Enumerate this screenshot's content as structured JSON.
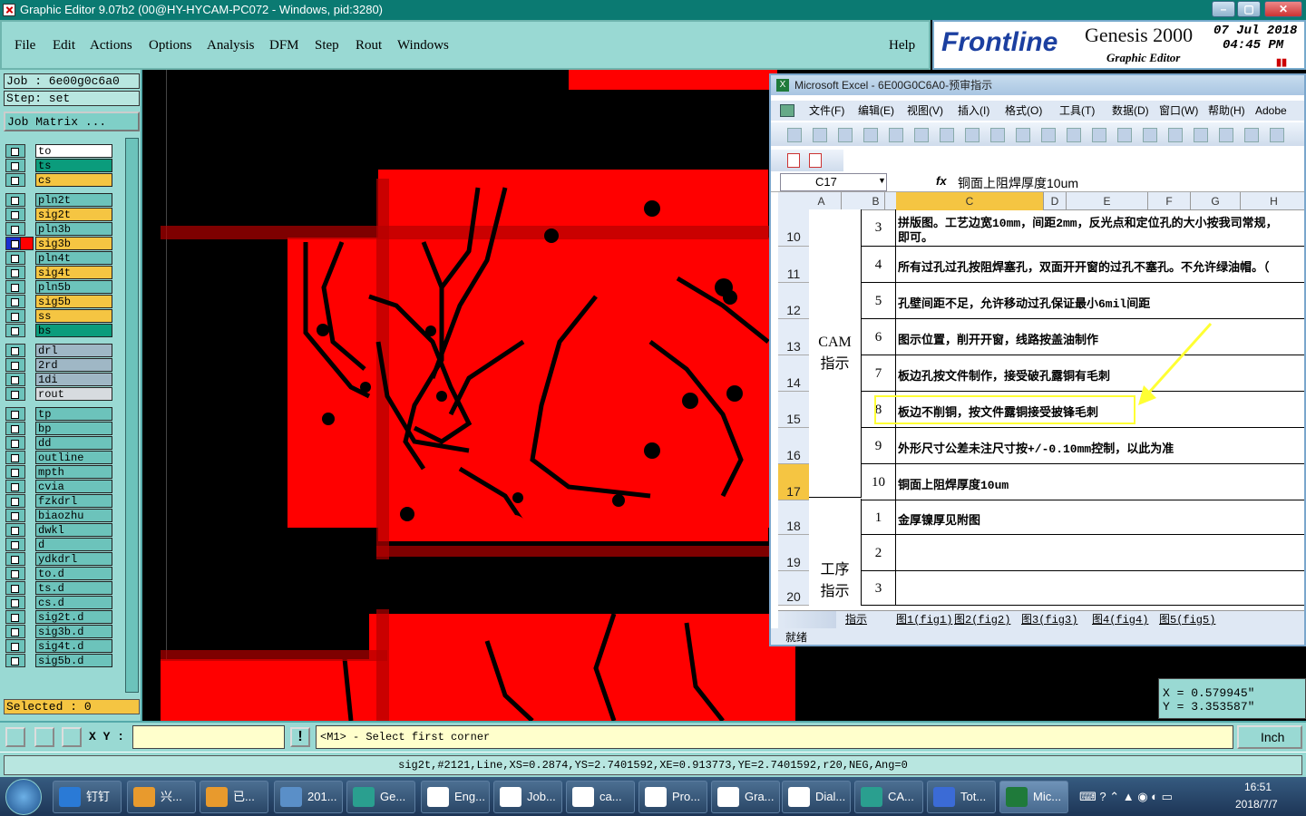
{
  "window": {
    "title": "Graphic Editor 9.07b2 (00@HY-HYCAM-PC072 - Windows, pid:3280)"
  },
  "menubar": {
    "items": [
      "File",
      "Edit",
      "Actions",
      "Options",
      "Analysis",
      "DFM",
      "Step",
      "Rout",
      "Windows"
    ],
    "help": "Help"
  },
  "brand": {
    "logo": "Frontline",
    "product": "Genesis 2000",
    "subtitle": "Graphic Editor",
    "date": "07 Jul 2018",
    "time": "04:45 PM"
  },
  "left_panel": {
    "job": "Job : 6e00g0c6a0",
    "step": "Step: set",
    "job_matrix": "Job Matrix ...",
    "layers": [
      {
        "name": "to",
        "color": "#ffffff"
      },
      {
        "name": "ts",
        "color": "#0b9c7c"
      },
      {
        "name": "cs",
        "color": "#f5c542"
      },
      {
        "name": "pln2t",
        "color": "#6cc3bb"
      },
      {
        "name": "sig2t",
        "color": "#f5c542"
      },
      {
        "name": "pln3b",
        "color": "#6cc3bb"
      },
      {
        "name": "sig3b",
        "color": "#f5c542"
      },
      {
        "name": "pln4t",
        "color": "#6cc3bb"
      },
      {
        "name": "sig4t",
        "color": "#f5c542"
      },
      {
        "name": "pln5b",
        "color": "#6cc3bb"
      },
      {
        "name": "sig5b",
        "color": "#f5c542"
      },
      {
        "name": "ss",
        "color": "#f5c542"
      },
      {
        "name": "bs",
        "color": "#0b9c7c"
      },
      {
        "name": "drl",
        "color": "#9fb7c5"
      },
      {
        "name": "2rd",
        "color": "#9fb7c5"
      },
      {
        "name": "1di",
        "color": "#9fb7c5"
      },
      {
        "name": "rout",
        "color": "#d7dbdf"
      },
      {
        "name": "tp",
        "color": "#6cc3bb"
      },
      {
        "name": "bp",
        "color": "#6cc3bb"
      },
      {
        "name": "dd",
        "color": "#6cc3bb"
      },
      {
        "name": "outline",
        "color": "#6cc3bb"
      },
      {
        "name": "mpth",
        "color": "#6cc3bb"
      },
      {
        "name": "cvia",
        "color": "#6cc3bb"
      },
      {
        "name": "fzkdrl",
        "color": "#6cc3bb"
      },
      {
        "name": "biaozhu",
        "color": "#6cc3bb"
      },
      {
        "name": "dwkl",
        "color": "#6cc3bb"
      },
      {
        "name": "d",
        "color": "#6cc3bb"
      },
      {
        "name": "ydkdrl",
        "color": "#6cc3bb"
      },
      {
        "name": "to.d",
        "color": "#6cc3bb"
      },
      {
        "name": "ts.d",
        "color": "#6cc3bb"
      },
      {
        "name": "cs.d",
        "color": "#6cc3bb"
      },
      {
        "name": "sig2t.d",
        "color": "#6cc3bb"
      },
      {
        "name": "sig3b.d",
        "color": "#6cc3bb"
      },
      {
        "name": "sig4t.d",
        "color": "#6cc3bb"
      },
      {
        "name": "sig5b.d",
        "color": "#6cc3bb"
      }
    ],
    "selected": "Selected : 0"
  },
  "command": {
    "xy_label": "X Y :",
    "prompt": "<M1> - Select first corner",
    "units": "Inch"
  },
  "coords": {
    "x": "X = 0.579945\"",
    "y": "Y = 3.353587\""
  },
  "status_line": "sig2t,#2121,Line,XS=0.2874,YS=2.7401592,XE=0.913773,YE=2.7401592,r20,NEG,Ang=0",
  "excel": {
    "title": "Microsoft Excel - 6E00G0C6A0-预审指示",
    "menu": [
      "文件(F)",
      "编辑(E)",
      "视图(V)",
      "插入(I)",
      "格式(O)",
      "工具(T)",
      "数据(D)",
      "窗口(W)",
      "帮助(H)",
      "Adobe"
    ],
    "cell_ref": "C17",
    "formula": "铜面上阻焊厚度10um",
    "columns": [
      "A",
      "B",
      "C",
      "D",
      "E",
      "F",
      "G",
      "H"
    ],
    "rows": [
      {
        "row": "10",
        "num": "3",
        "text": "拼版图。工艺边宽10mm，间距2mm，反光点和定位孔的大小按我司常规，",
        "text2": "即可。"
      },
      {
        "row": "11",
        "num": "4",
        "text": "所有过孔过孔按阻焊塞孔，双面开开窗的过孔不塞孔。不允许绿油帽。（"
      },
      {
        "row": "12",
        "num": "5",
        "text": "孔壁间距不足，允许移动过孔保证最小6mil间距"
      },
      {
        "row": "13",
        "num": "6",
        "text": "图示位置，削开开窗，线路按盖油制作"
      },
      {
        "row": "14",
        "num": "7",
        "text": "板边孔按文件制作，接受破孔露铜有毛刺"
      },
      {
        "row": "15",
        "num": "8",
        "text": "板边不削铜，按文件露铜接受披锋毛刺"
      },
      {
        "row": "16",
        "num": "9",
        "text": "外形尺寸公差未注尺寸按+/-0.10mm控制，以此为准"
      },
      {
        "row": "17",
        "num": "10",
        "text": "铜面上阻焊厚度10um"
      },
      {
        "row": "18",
        "num": "1",
        "text": "金厚镍厚见附图"
      },
      {
        "row": "19",
        "num": "2",
        "text": ""
      },
      {
        "row": "20",
        "num": "3",
        "text": ""
      }
    ],
    "group_a1": "CAM\n指示",
    "group_a2": "工序\n指示",
    "tabs": [
      "指示",
      "图1(fig1)",
      "图2(fig2)",
      "图3(fig3)",
      "图4(fig4)",
      "图5(fig5)"
    ],
    "status": "就绪"
  },
  "taskbar": {
    "items": [
      "钉钉",
      "兴...",
      "已...",
      "201...",
      "Ge...",
      "Eng...",
      "Job...",
      "ca...",
      "Pro...",
      "Gra...",
      "Dial...",
      "CA...",
      "Tot...",
      "Mic..."
    ],
    "time": "16:51",
    "date": "2018/7/7"
  },
  "colors": {
    "copper": "#ff0000",
    "board": "#000000",
    "panel": "#99d9d3",
    "highlight": "#ffff33"
  }
}
